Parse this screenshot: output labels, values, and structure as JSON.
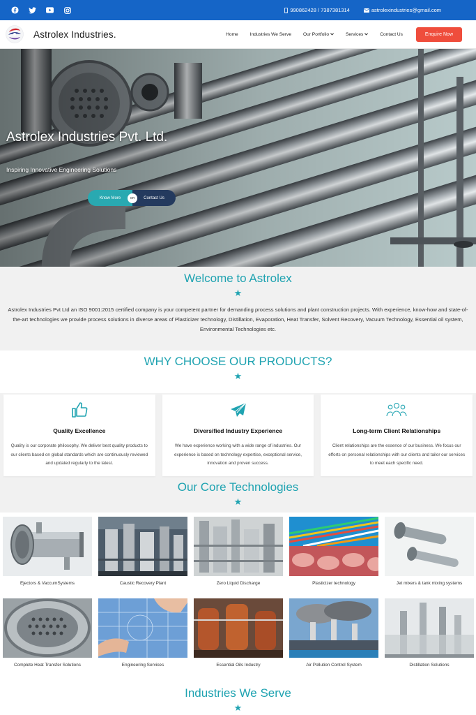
{
  "topbar": {
    "socials": [
      "facebook-icon",
      "twitter-icon",
      "youtube-icon",
      "instagram-icon"
    ],
    "phone": "990862428 / 7387381314",
    "email": "astrolexindustries@gmail.com"
  },
  "header": {
    "brand": "Astrolex Industries.",
    "nav": [
      {
        "label": "Home"
      },
      {
        "label": "Industries We Serve"
      },
      {
        "label": "Our Portfolio"
      },
      {
        "label": "Services"
      },
      {
        "label": "Contact Us"
      }
    ],
    "enquire": "Enquire Now"
  },
  "hero": {
    "title": "Astrolex Industries Pvt. Ltd.",
    "subtitle": "Inspiring Innovative Engineering Solutions",
    "know_more": "Know More",
    "or": "OR",
    "contact_us": "Contact Us"
  },
  "welcome": {
    "title": "Welcome to Astrolex",
    "text": "Astrolex Industries Pvt Ltd an ISO 9001:2015 certified company is your competent partner for demanding process solutions and plant construction projects. With experience, know-how and state-of-the-art technologies we provide process solutions in diverse areas of Plasticizer technology, Distillation, Evaporation, Heat Transfer, Solvent Recovery, Vacuum Technology, Essential oil system, Environmental Technologies etc."
  },
  "why": {
    "title": "WHY CHOOSE OUR PRODUCTS?",
    "cards": [
      {
        "icon": "thumbs-up-icon",
        "title": "Quality Excellence",
        "text": "Quality is our corporate philosophy. We deliver best quality products to our clients based on global standards which are continuously reviewed and updated regularly to the latest."
      },
      {
        "icon": "paper-plane-icon",
        "title": "Diversified Industry Experience",
        "text": "We have experience working with a wide range of industries. Our experience is based on technology expertise, exceptional service, innovation and proven success."
      },
      {
        "icon": "users-icon",
        "title": "Long-term Client Relationships",
        "text": "Client relationships are the essence of our business. We focus our efforts on personal relationships with our clients and tailor our services to meet each specific need."
      }
    ]
  },
  "core": {
    "title": "Our Core Technologies",
    "items": [
      {
        "label": "Ejectors & VaccumSystems"
      },
      {
        "label": "Caustic Recovery Plant"
      },
      {
        "label": "Zero Liquid Discharge"
      },
      {
        "label": "Plasticizer technology"
      },
      {
        "label": "Jet mixers & tank mixing systems"
      },
      {
        "label": "Complete Heat Transfer Solutions"
      },
      {
        "label": "Engineering Services"
      },
      {
        "label": "Essential Oils Industry"
      },
      {
        "label": "Air Pollution Control System"
      },
      {
        "label": "Distillation Solutions"
      }
    ]
  },
  "industries": {
    "title": "Industries We Serve"
  },
  "colors": {
    "topbar": "#1565c7",
    "accent": "#1fa3b1",
    "enquire": "#ef4d3c",
    "know_more": "#29a9b1",
    "contact_btn": "#243a5e"
  }
}
